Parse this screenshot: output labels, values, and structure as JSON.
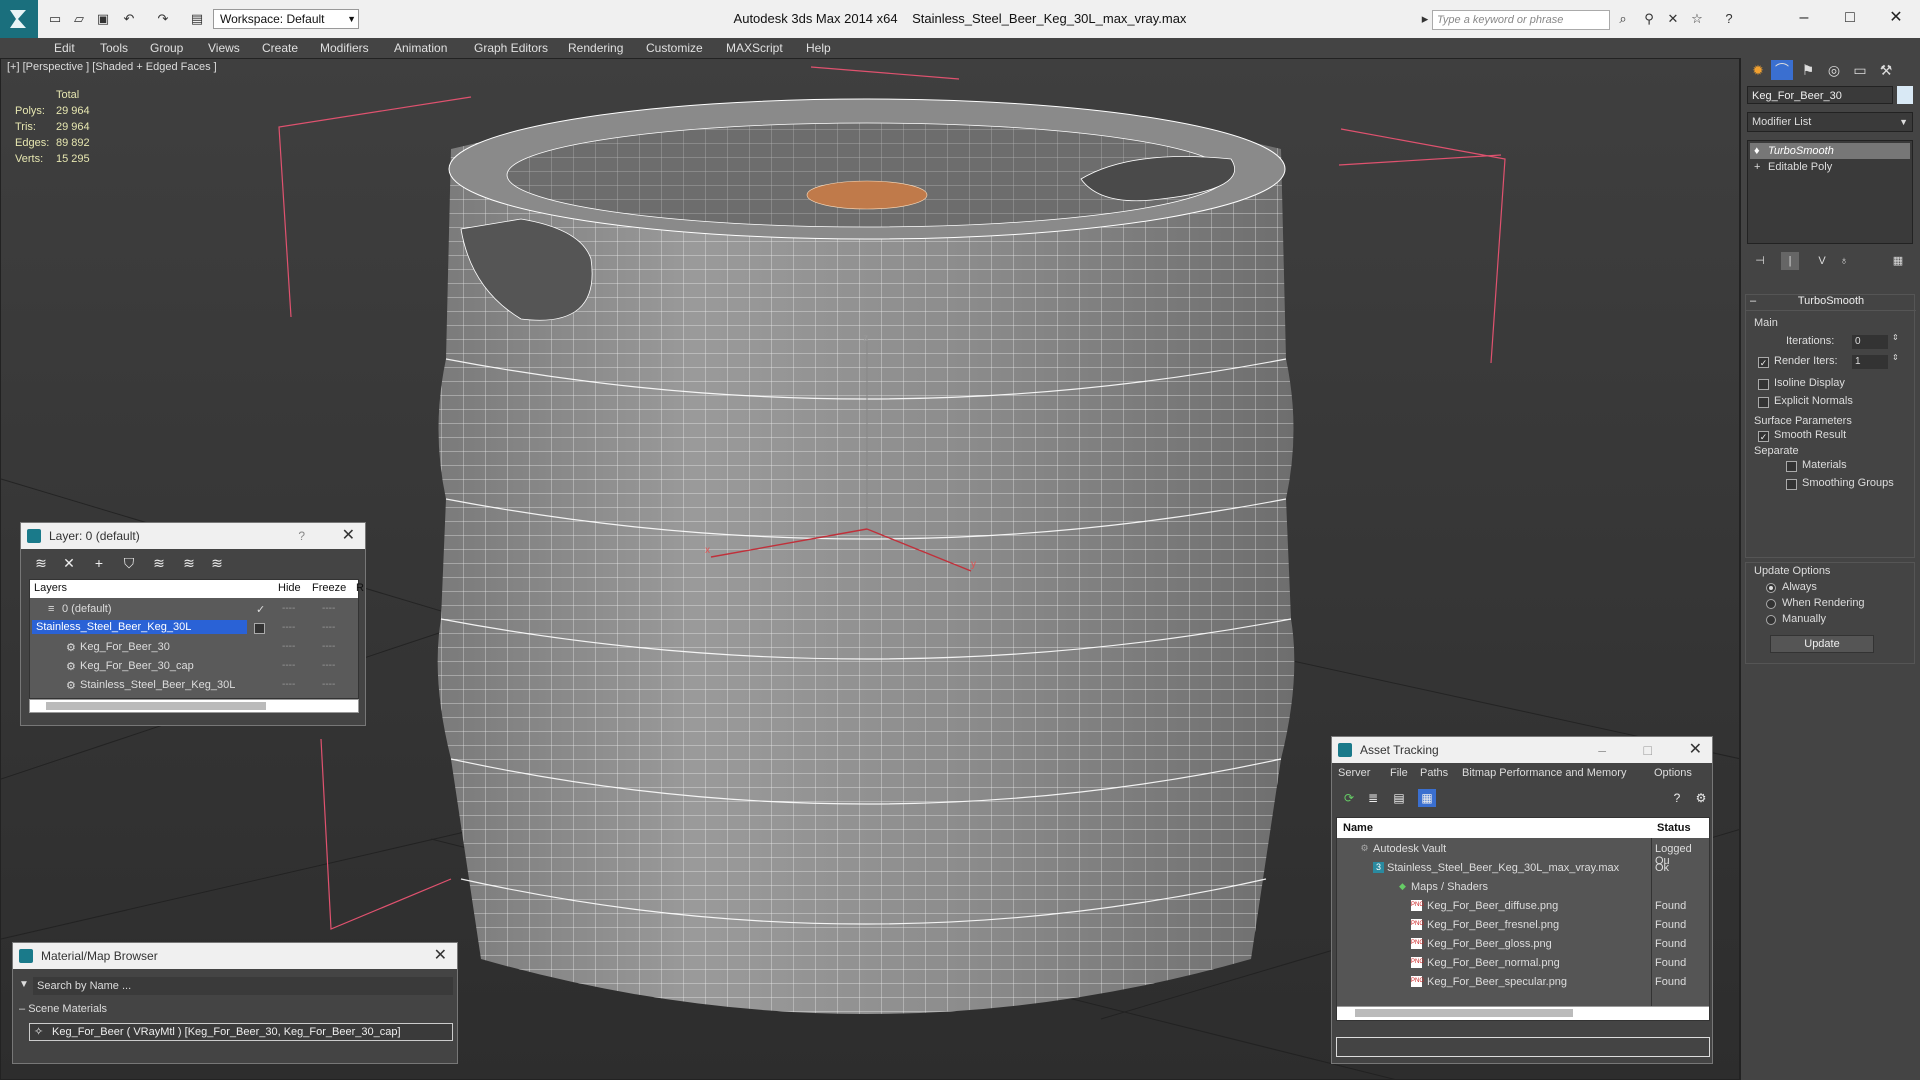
{
  "titlebar": {
    "workspace": "Workspace: Default",
    "app_title": "Autodesk 3ds Max  2014 x64",
    "file_name": "Stainless_Steel_Beer_Keg_30L_max_vray.max",
    "search_placeholder": "Type a keyword or phrase"
  },
  "menu": [
    "Edit",
    "Tools",
    "Group",
    "Views",
    "Create",
    "Modifiers",
    "Animation",
    "Graph Editors",
    "Rendering",
    "Customize",
    "MAXScript",
    "Help"
  ],
  "viewport": {
    "label": "[+] [Perspective ] [Shaded + Edged Faces ]",
    "stats": {
      "header": "Total",
      "rows": [
        {
          "label": "Polys:",
          "value": "29 964"
        },
        {
          "label": "Tris:",
          "value": "29 964"
        },
        {
          "label": "Edges:",
          "value": "89 892"
        },
        {
          "label": "Verts:",
          "value": "15 295"
        }
      ]
    },
    "axis_labels": {
      "z": "z",
      "x": "x",
      "y": "y"
    }
  },
  "layer_window": {
    "title": "Layer: 0 (default)",
    "help": "?",
    "columns": {
      "layers": "Layers",
      "hide": "Hide",
      "freeze": "Freeze",
      "render": "R"
    },
    "rows": [
      {
        "name": "0 (default)",
        "selected": false
      },
      {
        "name": "Stainless_Steel_Beer_Keg_30L",
        "selected": true
      },
      {
        "name": "Keg_For_Beer_30",
        "selected": false
      },
      {
        "name": "Keg_For_Beer_30_cap",
        "selected": false
      },
      {
        "name": "Stainless_Steel_Beer_Keg_30L",
        "selected": false
      }
    ],
    "dash": "----"
  },
  "material_browser": {
    "title": "Material/Map Browser",
    "search": "Search by Name ...",
    "section": "Scene Materials",
    "item": "Keg_For_Beer  ( VRayMtl )  [Keg_For_Beer_30, Keg_For_Beer_30_cap]"
  },
  "asset_tracking": {
    "title": "Asset Tracking",
    "menu": [
      "Server",
      "File",
      "Paths",
      "Bitmap Performance and Memory",
      "Options"
    ],
    "columns": {
      "name": "Name",
      "status": "Status"
    },
    "rows": [
      {
        "name": "Autodesk Vault",
        "status": "Logged Ou"
      },
      {
        "name": "Stainless_Steel_Beer_Keg_30L_max_vray.max",
        "status": "Ok"
      },
      {
        "name": "Maps / Shaders",
        "status": ""
      },
      {
        "name": "Keg_For_Beer_diffuse.png",
        "status": "Found"
      },
      {
        "name": "Keg_For_Beer_fresnel.png",
        "status": "Found"
      },
      {
        "name": "Keg_For_Beer_gloss.png",
        "status": "Found"
      },
      {
        "name": "Keg_For_Beer_normal.png",
        "status": "Found"
      },
      {
        "name": "Keg_For_Beer_specular.png",
        "status": "Found"
      }
    ]
  },
  "command_panel": {
    "object_name": "Keg_For_Beer_30",
    "modifier_list": "Modifier List",
    "stack": [
      "TurboSmooth",
      "Editable Poly"
    ],
    "turbosmooth": {
      "title": "TurboSmooth",
      "main": "Main",
      "iterations_label": "Iterations:",
      "iterations": "0",
      "render_iters_label": "Render Iters:",
      "render_iters": "1",
      "isoline": "Isoline Display",
      "explicit_normals": "Explicit Normals",
      "surface_params": "Surface Parameters",
      "smooth_result": "Smooth Result",
      "separate": "Separate",
      "materials": "Materials",
      "smoothing_groups": "Smoothing Groups",
      "update_options": "Update Options",
      "always": "Always",
      "when_rendering": "When Rendering",
      "manually": "Manually",
      "update_button": "Update"
    }
  },
  "colors": {
    "accent": "#1a6f7d",
    "selection": "#2a62d6",
    "wire": "#ffffff",
    "bounding_box": "#e0526f"
  }
}
